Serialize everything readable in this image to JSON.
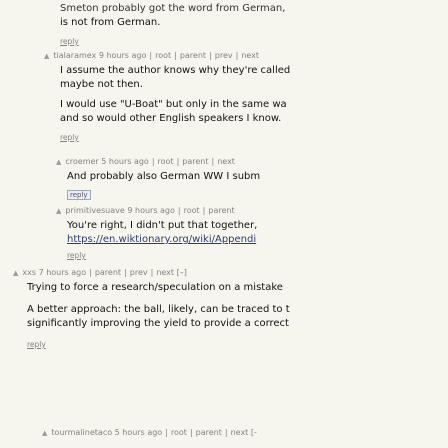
{
  "thread": {
    "c0": {
      "line1": "Smeton probably got the word from German,",
      "line2": "is not from German.",
      "reply": "reply"
    },
    "c1": {
      "user": "tialaramex",
      "age": "9 hours ago",
      "root": "root",
      "parent": "parent",
      "prev": "prev",
      "next": "next",
      "p1_line1": "I assume the author knows why they're called",
      "p1_line2": "maybe not then.",
      "p2_line1": "I would use \"U-Boat\" but only in the same wa",
      "p2_line2": "and so would other English speakers I know.",
      "reply": "reply"
    },
    "c2": {
      "user": "croemer",
      "age": "5 hours ago",
      "root": "root",
      "parent": "parent",
      "next": "next",
      "line1": "And probably also German WW I subm",
      "reply": "reply"
    },
    "c3": {
      "user": "primitivesuave",
      "age": "9 hours ago",
      "root": "root",
      "parent": "parent",
      "line1": "You're right, I didn't put that together,",
      "link": "https://en.wiktionary.org/wiki/Appendi",
      "reply": "reply"
    },
    "c4": {
      "user": "xxs",
      "age": "7 hours ago",
      "parent": "parent",
      "prev": "prev",
      "next": "next",
      "collapse": "[–]",
      "line1": "Trying to force a research/speculation on a mistake",
      "line2": "A better approach: the ball, likely, can be traced to t",
      "line3": "significantly improving the yield to provide a correct",
      "reply": "reply"
    },
    "c5": {
      "user": "tourmalinetaco",
      "age": "5 hours ago",
      "root": "root",
      "parent": "parent",
      "next": "next [-"
    }
  },
  "separator": "|",
  "arrow": "▲"
}
